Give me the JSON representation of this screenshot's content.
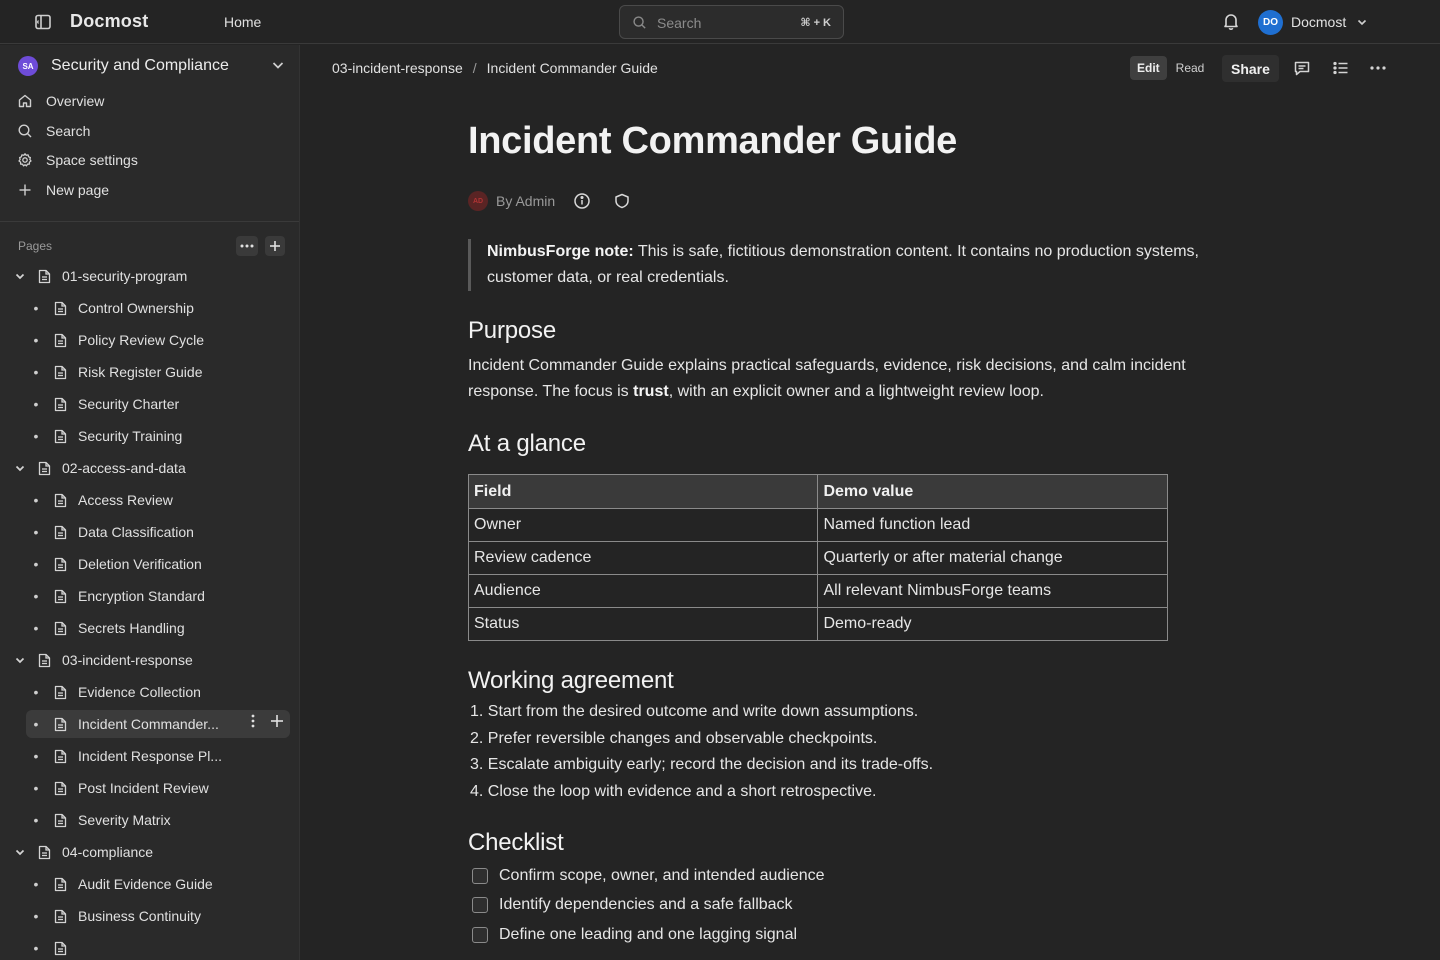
{
  "topbar": {
    "logo": "Docmost",
    "home": "Home",
    "search_placeholder": "Search",
    "search_shortcut": "⌘ + K",
    "user_initials": "DO",
    "user_name": "Docmost",
    "icons": [
      "sidebar-toggle-icon",
      "search-icon",
      "bell-icon",
      "chevron-down-icon"
    ]
  },
  "sidebar": {
    "space": {
      "initials": "SA",
      "name": "Security and Compliance"
    },
    "nav": [
      {
        "label": "Overview",
        "icon": "home-icon"
      },
      {
        "label": "Search",
        "icon": "search-icon"
      },
      {
        "label": "Space settings",
        "icon": "gear-icon"
      },
      {
        "label": "New page",
        "icon": "plus-icon"
      }
    ],
    "pages_label": "Pages",
    "tree": [
      {
        "label": "01-security-program",
        "level": 0
      },
      {
        "label": "Control Ownership",
        "level": 1
      },
      {
        "label": "Policy Review Cycle",
        "level": 1
      },
      {
        "label": "Risk Register Guide",
        "level": 1
      },
      {
        "label": "Security Charter",
        "level": 1
      },
      {
        "label": "Security Training",
        "level": 1
      },
      {
        "label": "02-access-and-data",
        "level": 0
      },
      {
        "label": "Access Review",
        "level": 1
      },
      {
        "label": "Data Classification",
        "level": 1
      },
      {
        "label": "Deletion Verification",
        "level": 1
      },
      {
        "label": "Encryption Standard",
        "level": 1
      },
      {
        "label": "Secrets Handling",
        "level": 1
      },
      {
        "label": "03-incident-response",
        "level": 0
      },
      {
        "label": "Evidence Collection",
        "level": 1
      },
      {
        "label": "Incident Commander...",
        "level": 1,
        "active": true
      },
      {
        "label": "Incident Response Pl...",
        "level": 1
      },
      {
        "label": "Post Incident Review",
        "level": 1
      },
      {
        "label": "Severity Matrix",
        "level": 1
      },
      {
        "label": "04-compliance",
        "level": 0
      },
      {
        "label": "Audit Evidence Guide",
        "level": 1
      },
      {
        "label": "Business Continuity",
        "level": 1
      },
      {
        "label": "",
        "level": 1
      }
    ]
  },
  "header": {
    "breadcrumb": [
      "03-incident-response",
      "Incident Commander Guide"
    ],
    "breadcrumb_sep": "/",
    "mode_edit": "Edit",
    "mode_read": "Read",
    "share": "Share"
  },
  "document": {
    "title": "Incident Commander Guide",
    "author_initials": "AD",
    "byline": "By Admin",
    "callout_bold": "NimbusForge note:",
    "callout_text": " This is safe, fictitious demonstration content. It contains no production systems, customer data, or real credentials.",
    "purpose_heading": "Purpose",
    "purpose_pre": "Incident Commander Guide explains practical safeguards, evidence, risk decisions, and calm incident response. The focus is ",
    "purpose_bold": "trust",
    "purpose_post": ", with an explicit owner and a lightweight review loop.",
    "glance_heading": "At a glance",
    "table": {
      "headers": [
        "Field",
        "Demo value"
      ],
      "rows": [
        [
          "Owner",
          "Named function lead"
        ],
        [
          "Review cadence",
          "Quarterly or after material change"
        ],
        [
          "Audience",
          "All relevant NimbusForge teams"
        ],
        [
          "Status",
          "Demo-ready"
        ]
      ]
    },
    "agreement_heading": "Working agreement",
    "agreement": [
      "1. Start from the desired outcome and write down assumptions.",
      "2. Prefer reversible changes and observable checkpoints.",
      "3. Escalate ambiguity early; record the decision and its trade-offs.",
      "4. Close the loop with evidence and a short retrospective."
    ],
    "checklist_heading": "Checklist",
    "checklist": [
      "Confirm scope, owner, and intended audience",
      "Identify dependencies and a safe fallback",
      "Define one leading and one lagging signal"
    ]
  }
}
